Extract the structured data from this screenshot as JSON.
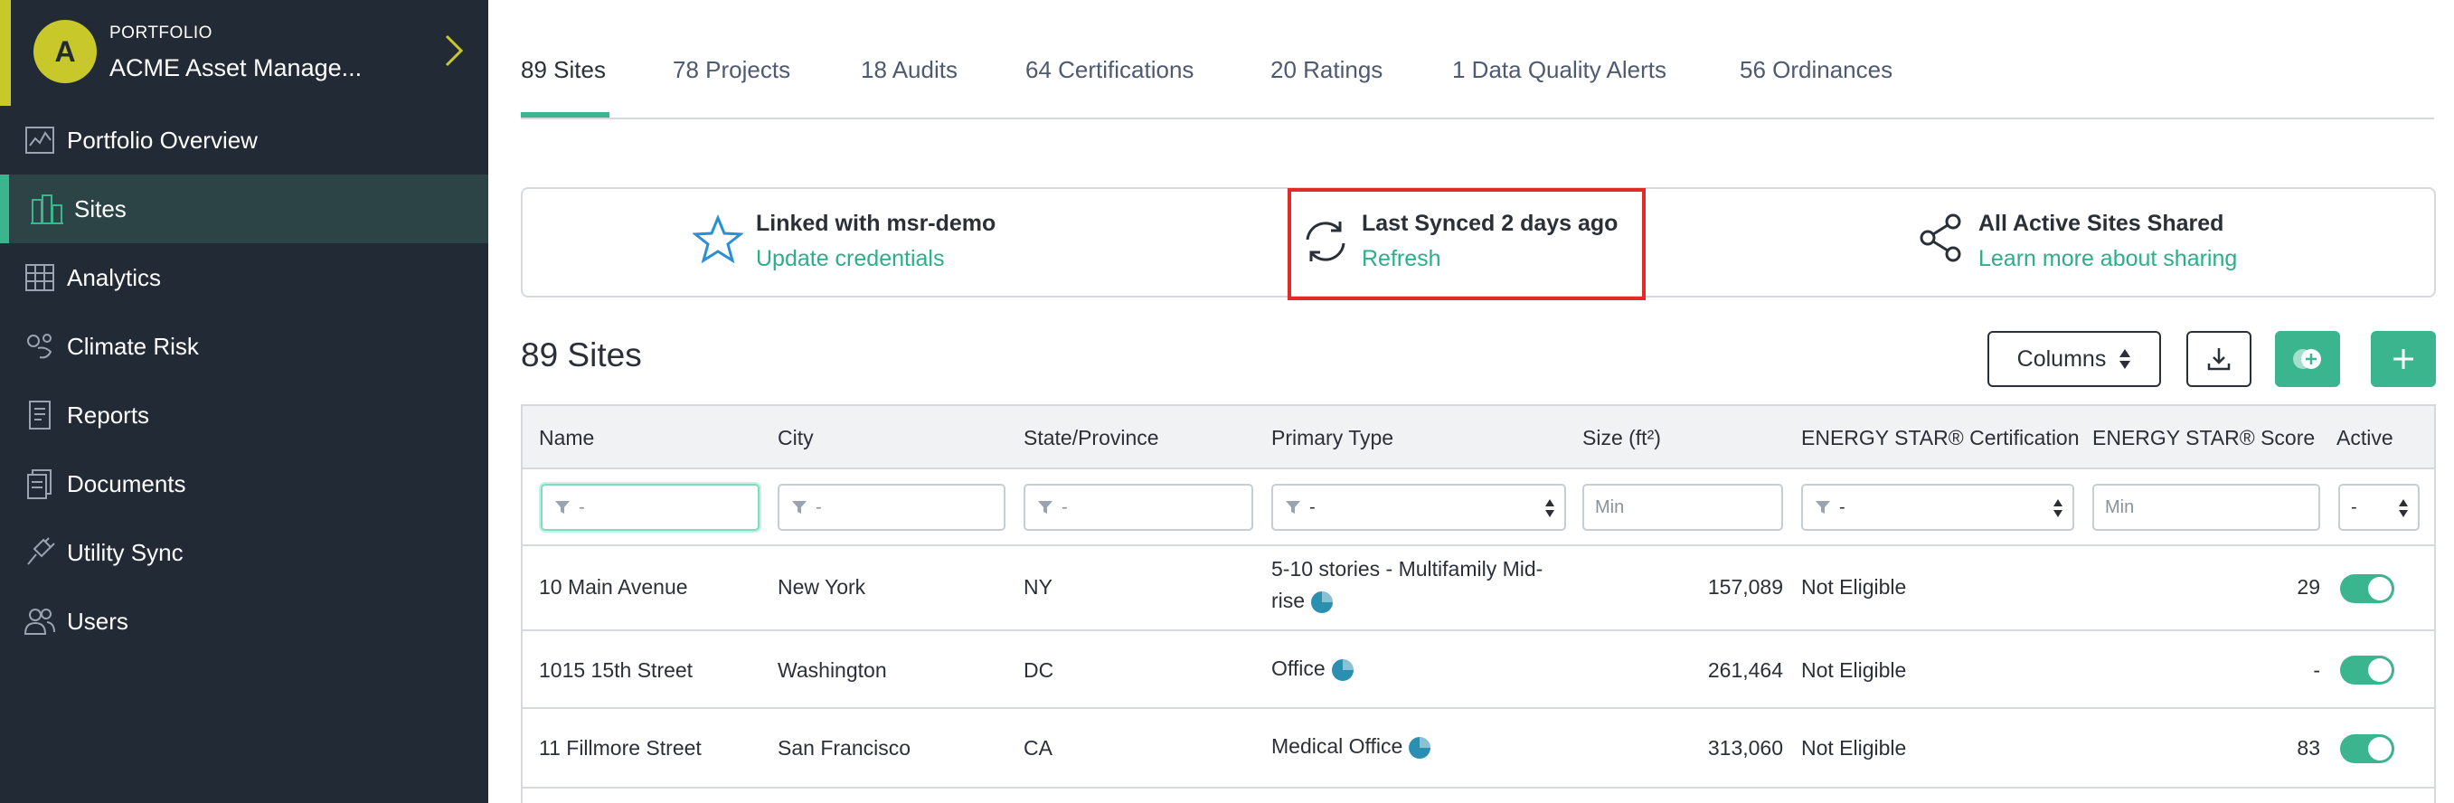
{
  "sidebar": {
    "account": {
      "avatar_letter": "A",
      "eyebrow": "PORTFOLIO",
      "name": "ACME Asset Manage..."
    },
    "items": [
      {
        "label": "Portfolio Overview",
        "icon": "portfolio-chart-icon"
      },
      {
        "label": "Sites",
        "icon": "buildings-icon",
        "active": true
      },
      {
        "label": "Analytics",
        "icon": "analytics-table-icon"
      },
      {
        "label": "Climate Risk",
        "icon": "climate-risk-icon"
      },
      {
        "label": "Reports",
        "icon": "report-icon"
      },
      {
        "label": "Documents",
        "icon": "documents-icon"
      },
      {
        "label": "Utility Sync",
        "icon": "plug-icon"
      },
      {
        "label": "Users",
        "icon": "users-icon"
      }
    ]
  },
  "tabs": [
    "89 Sites",
    "78 Projects",
    "18 Audits",
    "64 Certifications",
    "20 Ratings",
    "1 Data Quality Alerts",
    "56 Ordinances"
  ],
  "banner": {
    "linked_title": "Linked with msr-demo",
    "linked_link": "Update credentials",
    "sync_title": "Last Synced 2 days ago",
    "sync_link": "Refresh",
    "share_title": "All Active Sites Shared",
    "share_link": "Learn more about sharing"
  },
  "section": {
    "title": "89 Sites",
    "columns_button": "Columns"
  },
  "table": {
    "headers": {
      "name": "Name",
      "city": "City",
      "state": "State/Province",
      "type": "Primary Type",
      "size": "Size (ft²)",
      "cert": "ENERGY STAR® Certification",
      "score": "ENERGY STAR® Score",
      "active": "Active"
    },
    "filters": {
      "dash": "-",
      "min": "Min"
    },
    "rows": [
      {
        "name": "10 Main Avenue",
        "city": "New York",
        "state": "NY",
        "type_line1": "5-10 stories - Multifamily Mid-",
        "type_line2": "rise",
        "size": "157,089",
        "cert": "Not Eligible",
        "score": "29",
        "active": true
      },
      {
        "name": "1015 15th Street",
        "city": "Washington",
        "state": "DC",
        "type_line1": "Office",
        "size": "261,464",
        "cert": "Not Eligible",
        "score": "-",
        "active": true
      },
      {
        "name": "11 Fillmore Street",
        "city": "San Francisco",
        "state": "CA",
        "type_line1": "Medical Office",
        "size": "313,060",
        "cert": "Not Eligible",
        "score": "83",
        "active": true
      }
    ]
  },
  "colors": {
    "sidebar_bg": "#222a35",
    "accent_green": "#3bb58e",
    "avatar_yellow": "#c9c82a",
    "highlight_red": "#e32b26",
    "link_green": "#2dae86"
  }
}
